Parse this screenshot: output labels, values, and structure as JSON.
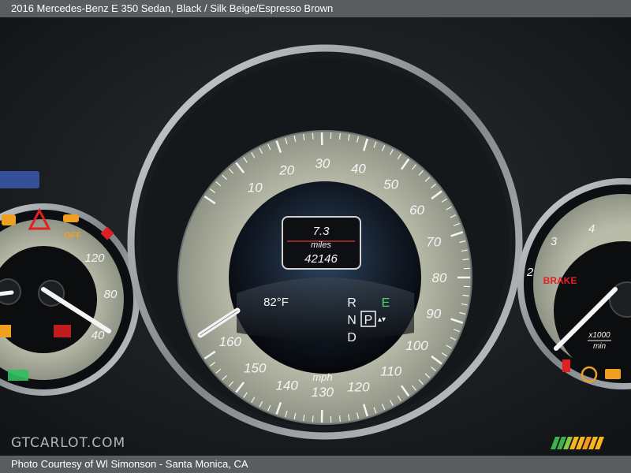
{
  "caption": {
    "title": "2016 Mercedes-Benz E 350 Sedan,  Black / Silk Beige/Espresso Brown",
    "credit": "Photo Courtesy of Wl Simonson - Santa Monica, CA"
  },
  "watermark": "GTCARLOT.COM",
  "speedometer": {
    "tick_labels": [
      "10",
      "20",
      "30",
      "40",
      "50",
      "60",
      "70",
      "80",
      "90",
      "100",
      "110",
      "120",
      "130",
      "140",
      "150",
      "160"
    ],
    "unit": "mph",
    "display": {
      "range_value": "7.3",
      "range_unit": "miles",
      "odometer": "42146",
      "temperature": "82°F",
      "gears": [
        "R",
        "N",
        "P",
        "D"
      ],
      "eco_label": "E",
      "selected_gear": "P"
    }
  },
  "left_gauge": {
    "tick_labels": [
      "120",
      "80",
      "40"
    ],
    "off_label": "OFF"
  },
  "tachometer": {
    "tick_labels": [
      "2",
      "3",
      "4"
    ],
    "brake_label": "BRAKE",
    "unit_top": "x1000",
    "unit_bottom": "min"
  },
  "colors": {
    "dial_face": "#a7ab9a",
    "ring": "#9aa0a3",
    "warning_red": "#e02020",
    "warning_amber": "#f0a020",
    "needle": "#f4f4f4"
  }
}
